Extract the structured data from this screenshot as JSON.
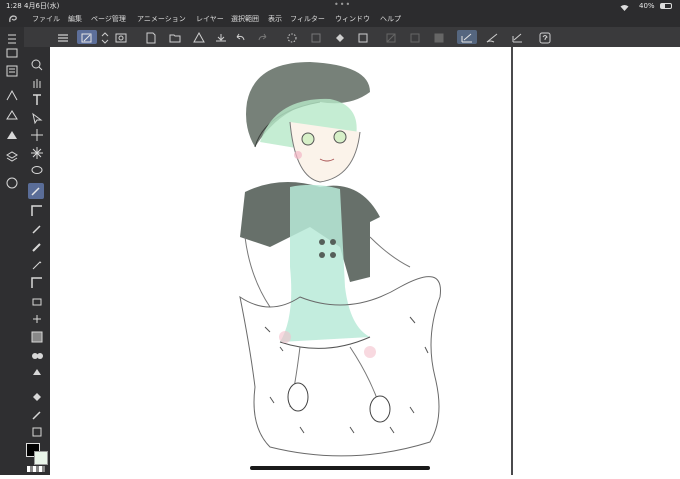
{
  "status": {
    "time": "1:28",
    "date": "4月6日(水)",
    "battery": "40%"
  },
  "menu": {
    "items": [
      "ファイル",
      "編集",
      "ページ管理",
      "アニメーション",
      "レイヤー",
      "選択範囲",
      "表示",
      "フィルター",
      "ウィンドウ",
      "ヘルプ"
    ]
  },
  "toolbar": {
    "icons": [
      "menu-icon",
      "pen-tool-icon",
      "stepper-icon",
      "eye-icon",
      "new-file-icon",
      "folder-icon",
      "warning-icon",
      "undo-icon",
      "redo-icon",
      "loading-icon",
      "copy-icon",
      "fill-icon",
      "transform-icon",
      "layer-icon",
      "snap-icon",
      "ruler-icon",
      "pen-check-icon",
      "pen-fill-icon",
      "pen-line-icon",
      "help-icon"
    ]
  },
  "colors": {
    "chrome_dark": "#2c2c2e",
    "toolbar": "#3a3a3c",
    "accent": "#5d6f9a",
    "canvas": "#ffffff"
  }
}
